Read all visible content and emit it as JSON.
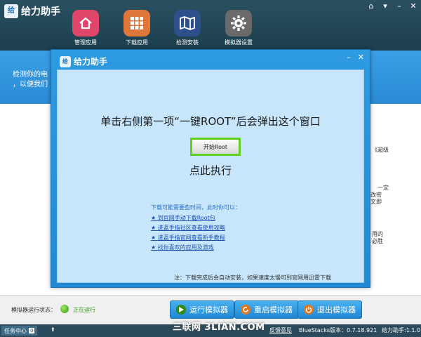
{
  "app": {
    "title": "给力助手",
    "logo_mark": "给"
  },
  "window_controls": {
    "icons": [
      "home-icon",
      "menu-icon",
      "minimize-icon",
      "close-icon"
    ]
  },
  "nav": [
    {
      "label": "管理应用",
      "icon": "house-icon",
      "color": "#e0456a"
    },
    {
      "label": "下载应用",
      "icon": "grid-icon",
      "color": "#e0773a"
    },
    {
      "label": "检测安装",
      "icon": "map-icon",
      "color": "#2d4f8c"
    },
    {
      "label": "模拟器设置",
      "icon": "gear-icon",
      "color": "#6a6a6a"
    }
  ],
  "strip": {
    "line1": "检测你的电",
    "line2": "，以便我们"
  },
  "side_fragments": [
    "《超级",
    "一定",
    "改密",
    "文即",
    "用的",
    "必胜"
  ],
  "dialog": {
    "title": "给力助手",
    "controls": [
      "minimize-icon",
      "close-icon"
    ],
    "headline": "单击右侧第一项“一键ROOT”后会弹出这个窗口",
    "root_button": "开始Root",
    "subhead": "点此执行",
    "info": "下载可能需要些时间，此时你可以：",
    "links": [
      "到官网手动下载Root包",
      "进蓝手指社区查看使用攻略",
      "进蓝手指官网查看新手教程",
      "找你喜欢的应用及游戏"
    ],
    "note": "注：下载完成后会自动安装，如果速度太慢可到官网用迅雷下载"
  },
  "status": {
    "label": "模拟器运行状态：",
    "value": "正在运行",
    "buttons": [
      {
        "label": "运行模拟器",
        "icon": "play-icon",
        "color": "#2f8a1a"
      },
      {
        "label": "重启模拟器",
        "icon": "restart-icon",
        "color": "#e0771f"
      },
      {
        "label": "退出模拟器",
        "icon": "power-icon",
        "color": "#e0771f"
      }
    ]
  },
  "taskbar": {
    "task_center": "任务中心",
    "task_count": "0",
    "feedback": "反馈意见",
    "version_bluestacks": "BlueStacks版本：0.7.18.921",
    "version_app": "给力助手:1.1.0",
    "watermark": "三联网 3LIAN.COM"
  }
}
